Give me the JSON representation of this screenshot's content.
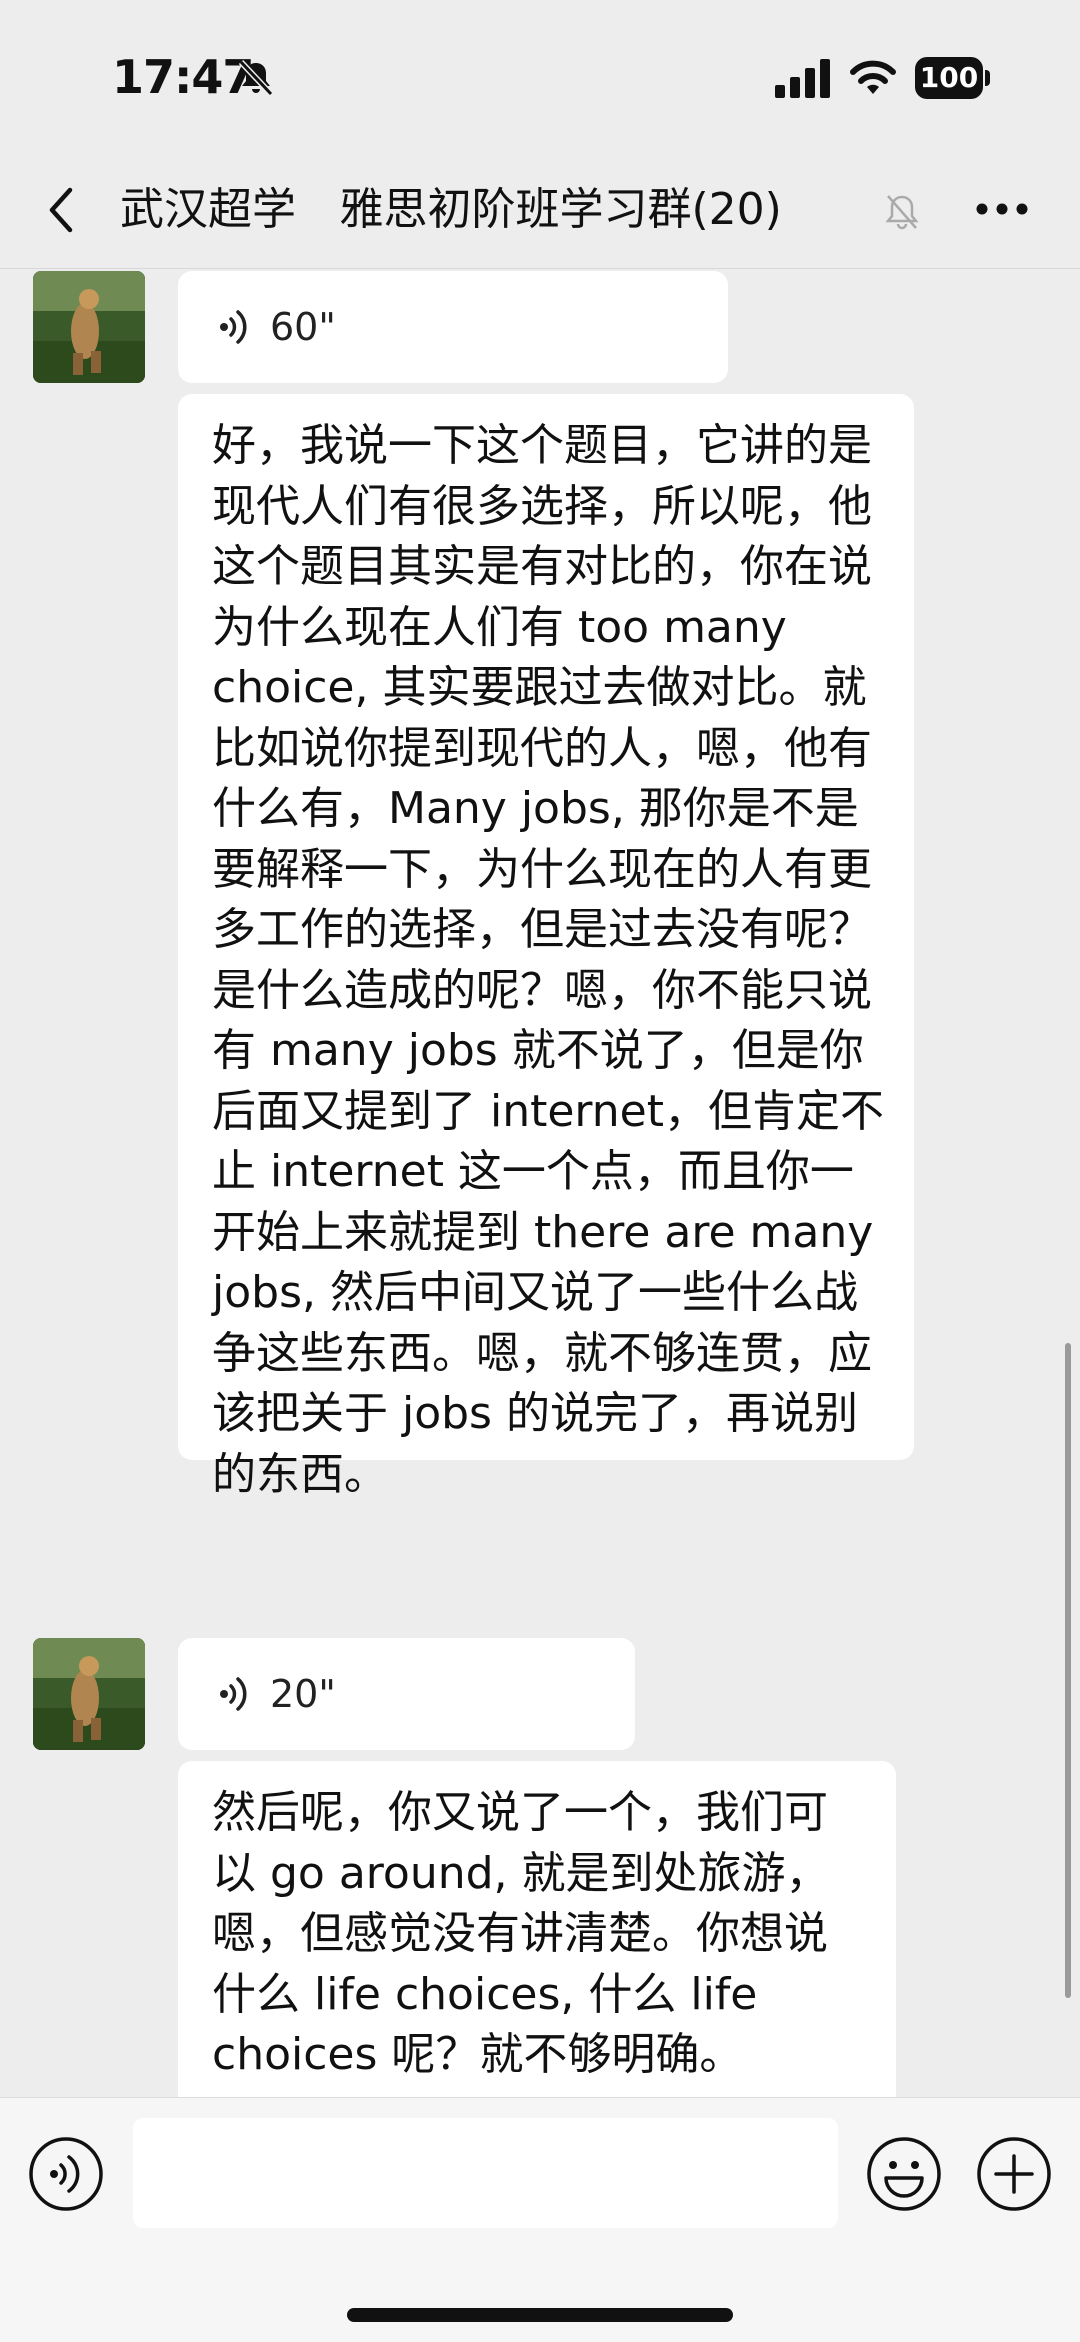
{
  "status_bar": {
    "time": "17:47",
    "battery": "100"
  },
  "header": {
    "title": "武汉超学   雅思初阶班学习群(20)"
  },
  "messages": [
    {
      "type": "voice",
      "duration": "60\""
    },
    {
      "type": "text",
      "text": "好，我说一下这个题目，它讲的是现代人们有很多选择，所以呢，他这个题目其实是有对比的，你在说为什么现在人们有 too many choice, 其实要跟过去做对比。就比如说你提到现代的人，嗯，他有什么有，Many jobs, 那你是不是要解释一下，为什么现在的人有更多工作的选择，但是过去没有呢？是什么造成的呢？嗯，你不能只说有 many jobs 就不说了，但是你后面又提到了 internet，但肯定不止 internet 这一个点，而且你一开始上来就提到 there are many jobs, 然后中间又说了一些什么战争这些东西。嗯，就不够连贯，应该把关于 jobs 的说完了，再说别的东西。"
    },
    {
      "type": "voice",
      "duration": "20\""
    },
    {
      "type": "text",
      "text": "然后呢，你又说了一个，我们可以 go around, 就是到处旅游，嗯，但感觉没有讲清楚。你想说什么 life choices, 什么 life choices 呢？就不够明确。"
    }
  ],
  "input_bar": {
    "value": ""
  }
}
